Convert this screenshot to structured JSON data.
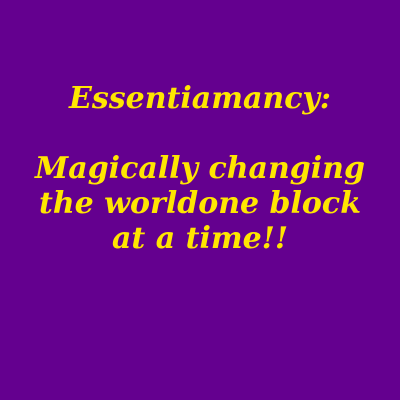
{
  "colors": {
    "background": "#64008F",
    "text": "#FFE600"
  },
  "heading": "Essentiamancy:",
  "tagline": [
    "Magically changing",
    "the worldone block",
    "at a time!!"
  ]
}
